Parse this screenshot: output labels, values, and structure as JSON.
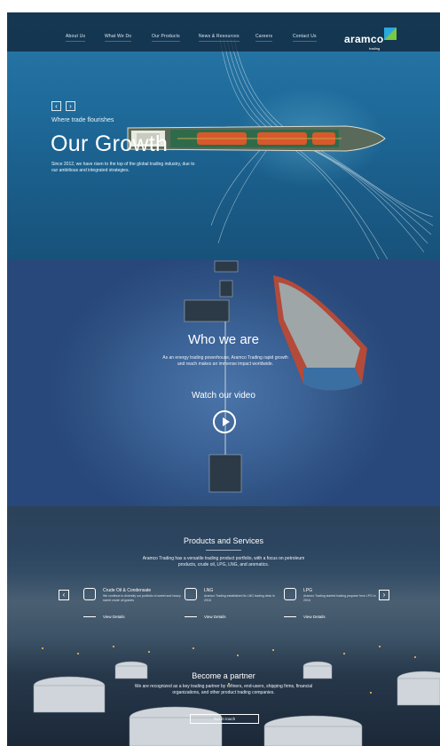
{
  "nav": {
    "items": [
      "About Us",
      "What We Do",
      "Our Products",
      "News & Resources",
      "Careers",
      "Contact Us"
    ]
  },
  "logo": {
    "name": "aramco",
    "sub": "trading"
  },
  "hero": {
    "kicker": "Where trade flourishes",
    "title": "Our Growth",
    "text": "Since 2012, we have risen to the top of the global trading industry, due to our ambitious and integrated strategies.",
    "prev": "‹",
    "next": "›"
  },
  "who": {
    "title": "Who we are",
    "text": "As an energy trading powerhouse, Aramco Trading rapid growth and reach makes an immense impact worldwide.",
    "watch": "Watch our video"
  },
  "products": {
    "title": "Products and Services",
    "text": "Aramco Trading has a versatile trading product portfolio, with a focus on petroleum products, crude oil, LPG, LNG, and aromatics.",
    "prev": "‹",
    "next": "›",
    "cards": [
      {
        "name": "Crude Oil & Condensate",
        "desc": "We continue to diversify our portfolio of sweet and heavy sweet crude oil grades",
        "link": "View Details",
        "icon": "barrel-icon"
      },
      {
        "name": "LNG",
        "desc": "Aramco Trading established its LNG trading desk in 2018",
        "link": "View Details",
        "icon": "lng-icon"
      },
      {
        "name": "LPG",
        "desc": "Aramco Trading started trading propane from LPG in 2016",
        "link": "View Details",
        "icon": "lpg-icon"
      }
    ]
  },
  "partner": {
    "title": "Become a partner",
    "text": "We are recognized as a key trading partner by refiners, end-users, shipping firms, financial organizations, and other product trading companies.",
    "button": "Get in touch"
  },
  "colors": {
    "brand_blue": "#2aa8e0",
    "brand_green": "#7ac943"
  }
}
